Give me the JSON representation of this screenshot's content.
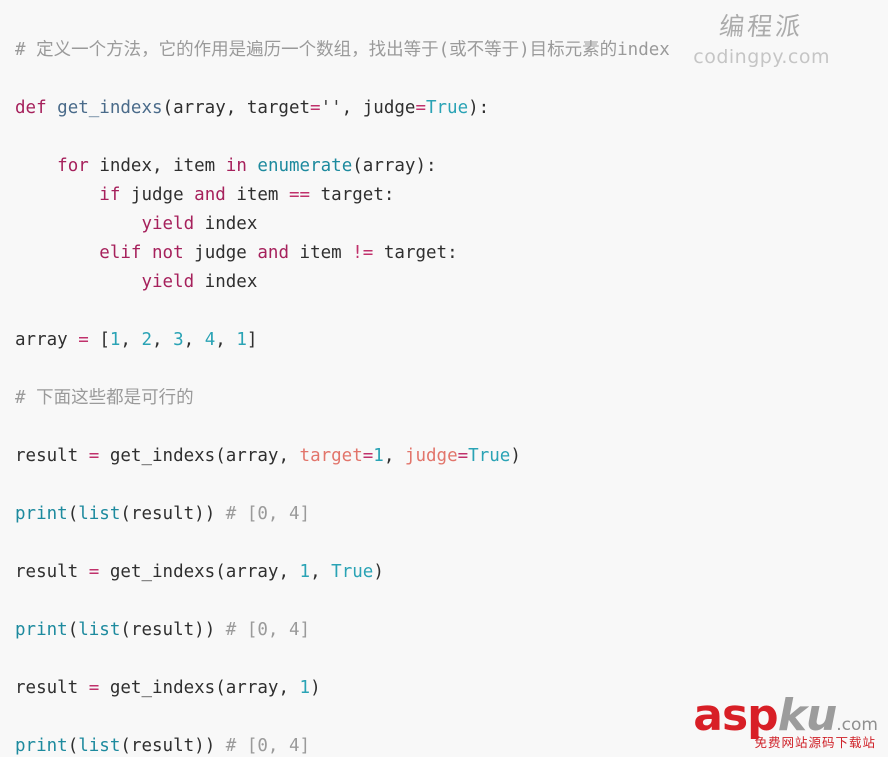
{
  "meta": {
    "language": "python",
    "background_color": "#f8f8f8",
    "default_text_color": "#2f2f2f"
  },
  "palette": {
    "keyword": "#a6215c",
    "operator": "#c0316b",
    "function_name": "#4a6b8a",
    "builtin": "#1d8a9e",
    "constant": "#2aa3b5",
    "number": "#2aa3b5",
    "string": "#3d3d3d",
    "keyword_argument": "#e2756b",
    "comment": "#9a9a9a"
  },
  "code": {
    "lines": [
      {
        "n": 1,
        "text": "# 定义一个方法，它的作用是遍历一个数组，找出等于(或不等于)目标元素的index"
      },
      {
        "n": 2,
        "text": ""
      },
      {
        "n": 3,
        "text": "def get_indexs(array, target='', judge=True):"
      },
      {
        "n": 4,
        "text": ""
      },
      {
        "n": 5,
        "text": "    for index, item in enumerate(array):"
      },
      {
        "n": 6,
        "text": "        if judge and item == target:"
      },
      {
        "n": 7,
        "text": "            yield index"
      },
      {
        "n": 8,
        "text": "        elif not judge and item != target:"
      },
      {
        "n": 9,
        "text": "            yield index"
      },
      {
        "n": 10,
        "text": ""
      },
      {
        "n": 11,
        "text": "array = [1, 2, 3, 4, 1]"
      },
      {
        "n": 12,
        "text": ""
      },
      {
        "n": 13,
        "text": "# 下面这些都是可行的"
      },
      {
        "n": 14,
        "text": ""
      },
      {
        "n": 15,
        "text": "result = get_indexs(array, target=1, judge=True)"
      },
      {
        "n": 16,
        "text": ""
      },
      {
        "n": 17,
        "text": "print(list(result)) # [0, 4]"
      },
      {
        "n": 18,
        "text": ""
      },
      {
        "n": 19,
        "text": "result = get_indexs(array, 1, True)"
      },
      {
        "n": 20,
        "text": ""
      },
      {
        "n": 21,
        "text": "print(list(result)) # [0, 4]"
      },
      {
        "n": 22,
        "text": ""
      },
      {
        "n": 23,
        "text": "result = get_indexs(array, 1)"
      },
      {
        "n": 24,
        "text": ""
      },
      {
        "n": 25,
        "text": "print(list(result)) # [0, 4]"
      }
    ],
    "tokens": {
      "comment_header": "# 定义一个方法，它的作用是遍历一个数组，找出等于(或不等于)目标元素的index",
      "comment_usable": "# 下面这些都是可行的",
      "comment_output": "# [0, 4]",
      "kw_def": "def",
      "kw_for": "for",
      "kw_in": "in",
      "kw_if": "if",
      "kw_elif": "elif",
      "kw_and": "and",
      "kw_not": "not",
      "kw_yield": "yield",
      "fn_def_name": "get_indexs",
      "builtin_enumerate": "enumerate",
      "builtin_print": "print",
      "builtin_list": "list",
      "const_true": "True",
      "var_array": "array",
      "var_target": "target",
      "var_judge": "judge",
      "var_index": "index",
      "var_item": "item",
      "var_result": "result",
      "num_0": "0",
      "num_1": "1",
      "num_2": "2",
      "num_3": "3",
      "num_4": "4",
      "empty_string": "''",
      "op_assign": "=",
      "op_eq": "==",
      "op_ne": "!="
    }
  },
  "watermark_top": {
    "brand_cn": "编程派",
    "url": "codingpy.com"
  },
  "watermark_bottom": {
    "logo_asp": "asp",
    "logo_ku": "ku",
    "logo_dotcom": ".com",
    "subtitle": "免费网站源码下载站"
  }
}
